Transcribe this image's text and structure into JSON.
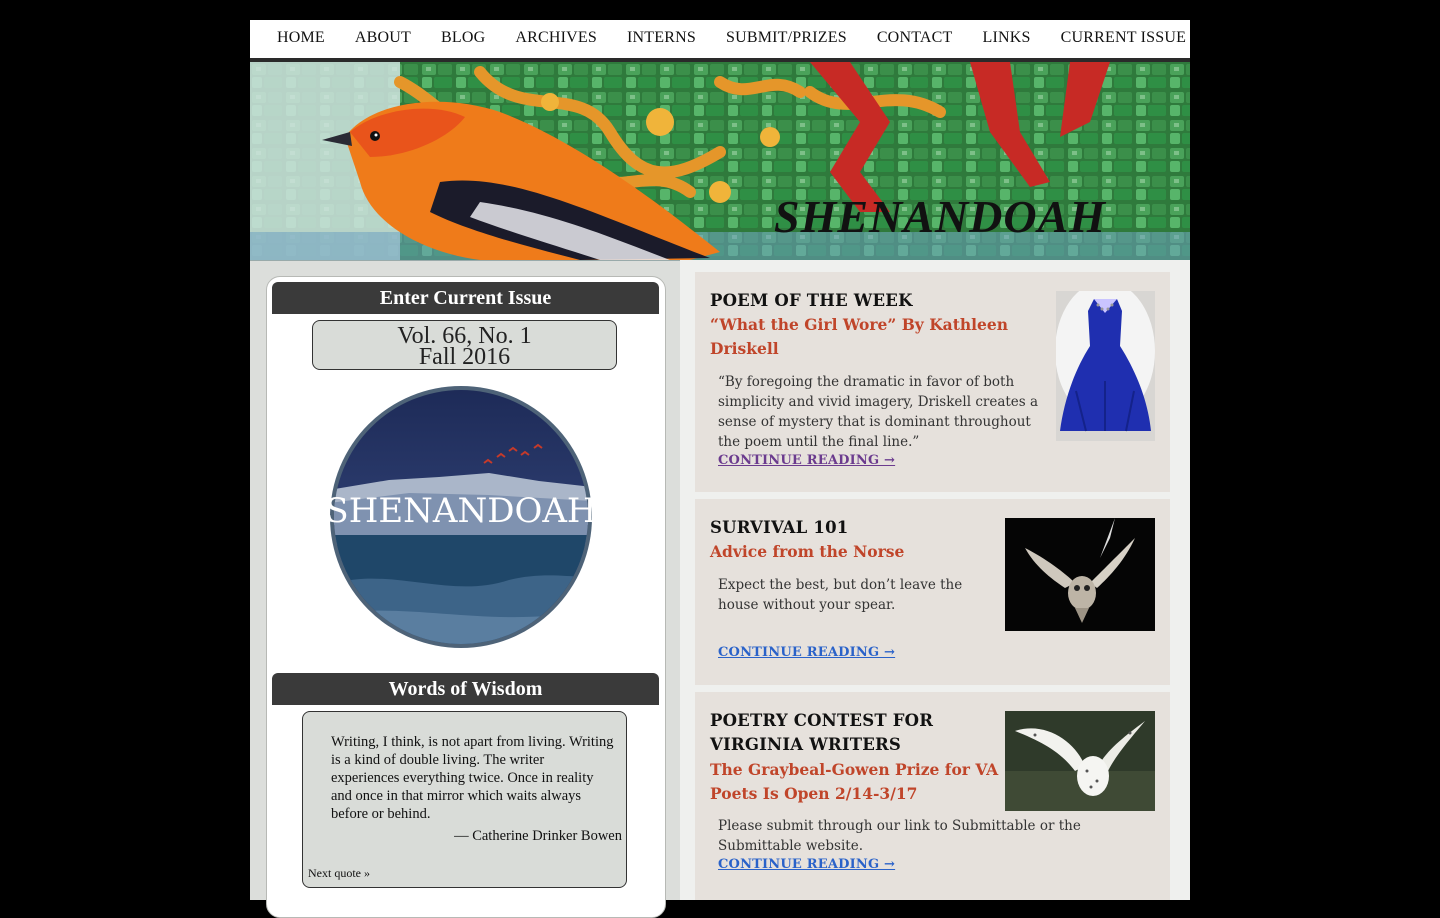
{
  "nav": {
    "items": [
      "HOME",
      "ABOUT",
      "BLOG",
      "ARCHIVES",
      "INTERNS",
      "SUBMIT/PRIZES",
      "CONTACT",
      "LINKS",
      "CURRENT ISSUE"
    ]
  },
  "banner": {
    "title": "SHENANDOAH"
  },
  "left": {
    "current_issue_heading": "Enter Current Issue",
    "issue_volume": "Vol. 66, No. 1",
    "issue_season": "Fall 2016",
    "logo_text": "SHENANDOAH",
    "wisdom_heading": "Words of Wisdom",
    "quote_text": "Writing, I think, is not apart from living. Writing is a kind of double living. The writer experiences everything twice. Once in reality and once in that mirror which waits always before or behind.",
    "quote_author": "— Catherine Drinker Bowen",
    "next_quote": "Next quote »"
  },
  "cards": [
    {
      "title": "POEM OF THE WEEK",
      "subtitle": "“What the Girl Wore” By Kathleen Driskell",
      "body": "“By foregoing the dramatic in favor of both simplicity and vivid imagery, Driskell creates a sense of mystery that is dominant throughout the poem until the final line.”",
      "link": "CONTINUE READING →",
      "link_color": "#6b3b8e"
    },
    {
      "title": "SURVIVAL 101",
      "subtitle": "Advice from the Norse",
      "body": "Expect the best, but don’t leave the house without your spear.",
      "link": "CONTINUE READING →",
      "link_color": "#2a62c9"
    },
    {
      "title": "POETRY CONTEST FOR VIRGINIA WRITERS",
      "subtitle": "The Graybeal-Gowen Prize for VA Poets Is Open 2/14-3/17",
      "body": "Please submit through our link to Submittable or the Submittable website.",
      "link": "CONTINUE READING →",
      "link_color": "#2a62c9"
    }
  ],
  "colors": {
    "accent_red": "#c0452a",
    "header_dark": "#3a3a3a",
    "card_bg": "#e6e1dc",
    "panel_bg": "#d9dcd8"
  }
}
